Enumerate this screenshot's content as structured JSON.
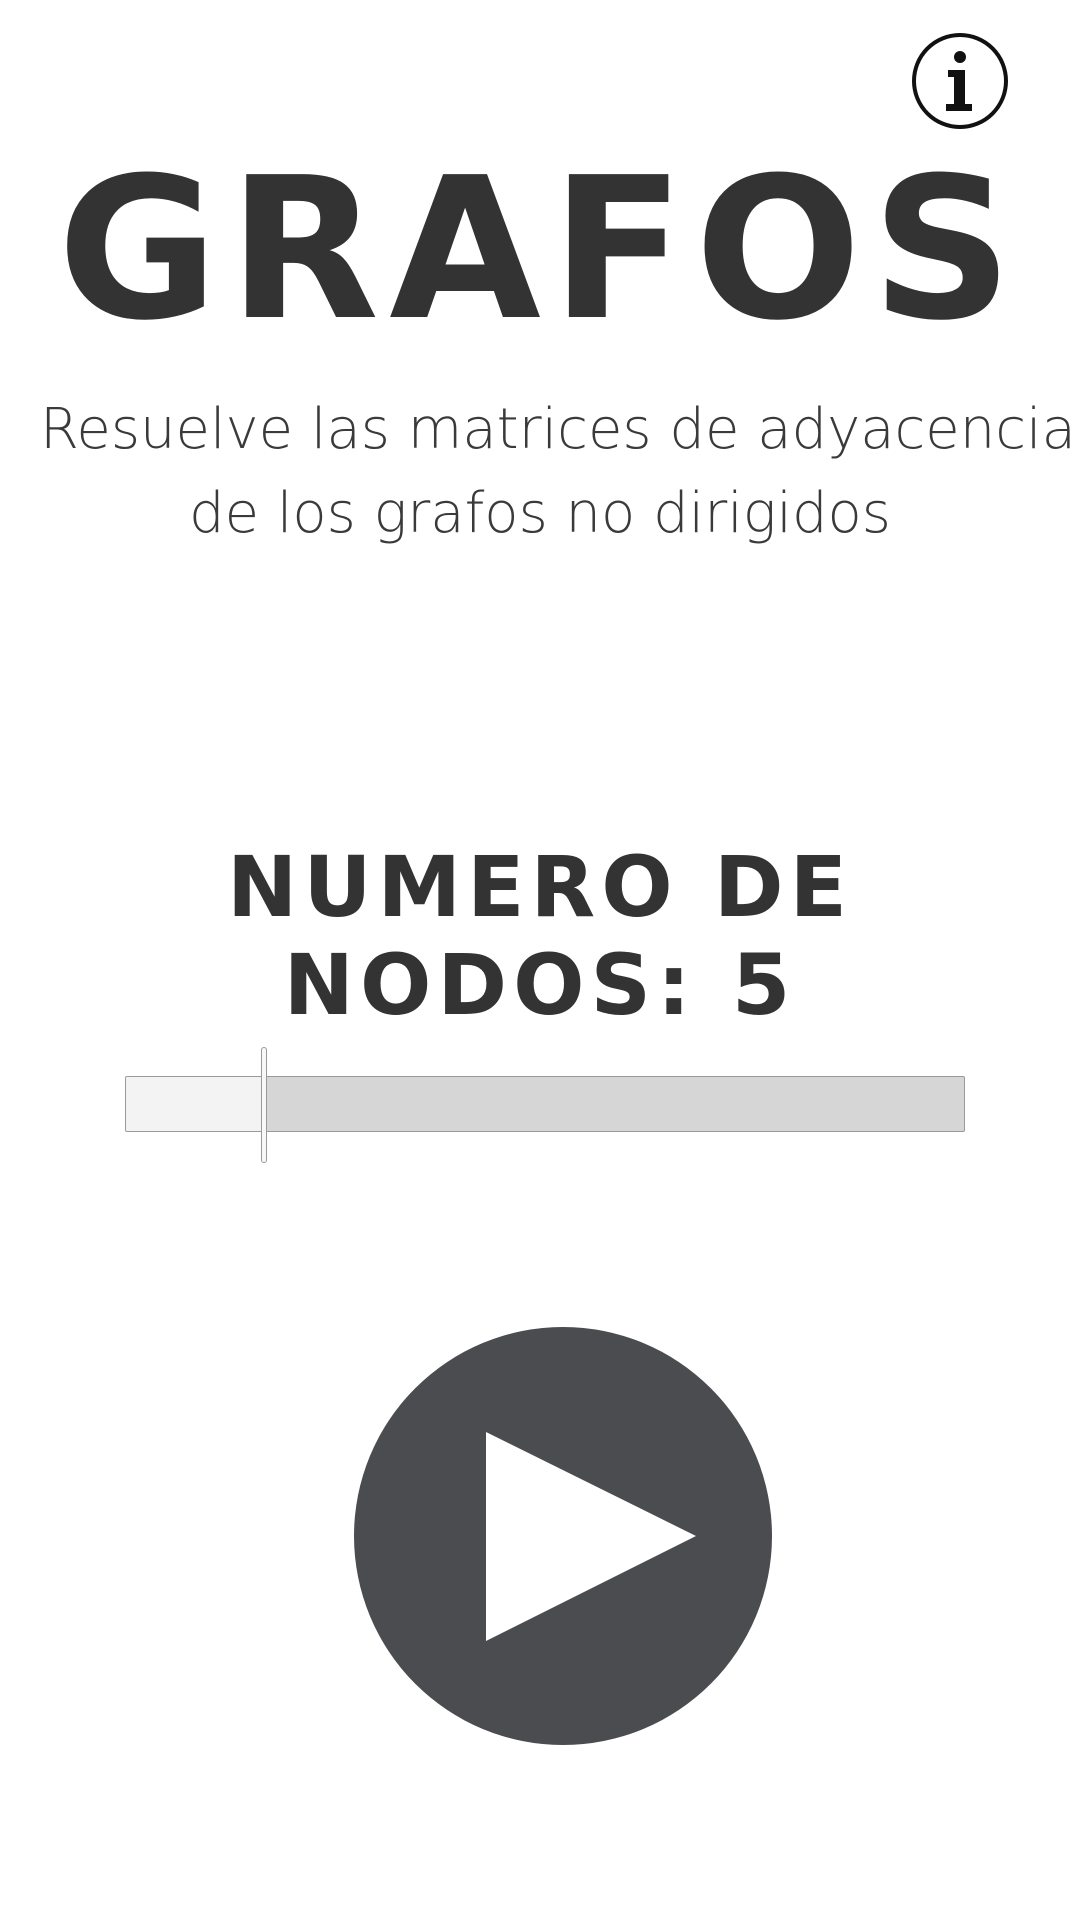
{
  "header": {
    "info_icon": "info-icon"
  },
  "app": {
    "title": "GRAFOS",
    "subtitle_lines": [
      "Resuelve las matrices de adyacencia",
      "de los grafos no dirigidos"
    ]
  },
  "node_selector": {
    "label_line1": "NUMERO DE",
    "label_line2": "NODOS:",
    "value": "5",
    "slider_fraction": 0.166
  },
  "play": {
    "icon": "play-icon"
  },
  "colors": {
    "text": "#333333",
    "play_button": "#4b4c4f",
    "track": "#d6d6d6",
    "track_fill": "#f3f3f3"
  }
}
